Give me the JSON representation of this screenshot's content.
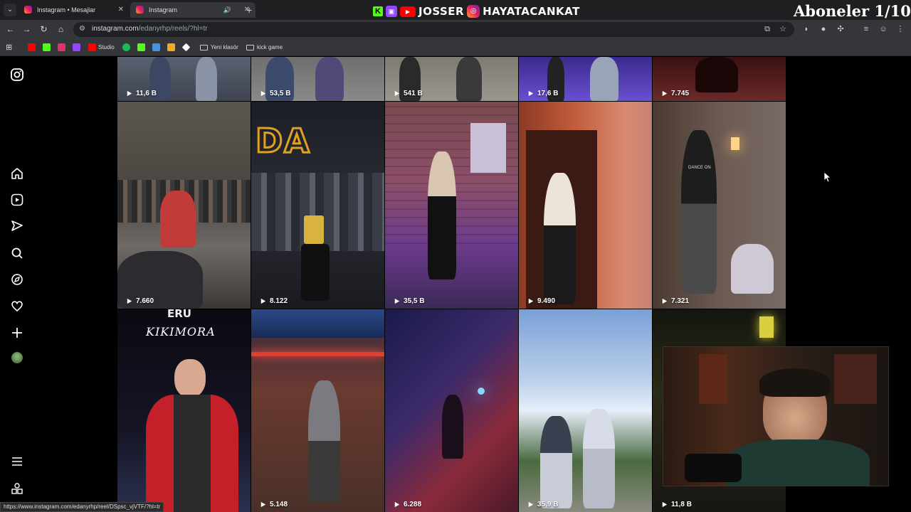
{
  "browser": {
    "tabs": [
      {
        "title": "Instagram • Mesajlar",
        "active": false
      },
      {
        "title": "Instagram",
        "active": true
      }
    ],
    "url_host": "instagram.com",
    "url_path": "/edanyrhp/reels/?hl=tr",
    "bookmarks": [
      {
        "label": "",
        "icon": "youtube-icon",
        "color": "#ff0000"
      },
      {
        "label": "",
        "icon": "kick-icon",
        "color": "#53fc18"
      },
      {
        "label": "",
        "icon": "instagram-icon",
        "color": "#e1306c"
      },
      {
        "label": "",
        "icon": "twitch-icon",
        "color": "#9146ff"
      },
      {
        "label": "Studio",
        "icon": "youtube-studio-icon",
        "color": "#ff0000"
      },
      {
        "label": "",
        "icon": "spotify-icon",
        "color": "#1db954"
      },
      {
        "label": "",
        "icon": "kick-icon",
        "color": "#53fc18"
      },
      {
        "label": "",
        "icon": "translate-icon",
        "color": "#4a90e2"
      },
      {
        "label": "",
        "icon": "chess-icon",
        "color": "#f5a623"
      },
      {
        "label": "",
        "icon": "diamond-icon",
        "color": "#ffffff"
      },
      {
        "label": "Yeni klasör",
        "icon": "folder-icon",
        "color": "#cccccc"
      },
      {
        "label": "kick game",
        "icon": "folder-icon",
        "color": "#cccccc"
      }
    ]
  },
  "stream_overlay": {
    "handle_1": "JOSSER",
    "handle_2": "HAYATACANKAT",
    "subs_counter": "Aboneler 1/10"
  },
  "sidebar": {
    "items": [
      "instagram-logo-icon",
      "home-icon",
      "reels-icon",
      "messages-icon",
      "search-icon",
      "explore-icon",
      "notifications-icon",
      "create-icon",
      "profile-avatar",
      "more-menu-icon",
      "threads-icon"
    ]
  },
  "reels": [
    {
      "views": "11,6 B"
    },
    {
      "views": "53,5 B"
    },
    {
      "views": "541 B"
    },
    {
      "views": "17,6 B"
    },
    {
      "views": "7.745"
    },
    {
      "views": "7.660"
    },
    {
      "views": "8.122"
    },
    {
      "views": "35,5 B"
    },
    {
      "views": "9.490"
    },
    {
      "views": "7.321"
    },
    {
      "views": ""
    },
    {
      "views": "5.148"
    },
    {
      "views": "6.288"
    },
    {
      "views": "35,9 B"
    },
    {
      "views": "11,8 B"
    }
  ],
  "reel_texts": {
    "top_caption": "ERU",
    "caption": "KIKIMORA",
    "sign_a": "DA",
    "sign_b": "DANCE ON"
  },
  "status_bar_url": "https://www.instagram.com/edanyrhp/reel/DSpsc_vjVTF/?hl=tr",
  "colors": {
    "browser_bg": "#35363a",
    "page_bg": "#000000"
  }
}
